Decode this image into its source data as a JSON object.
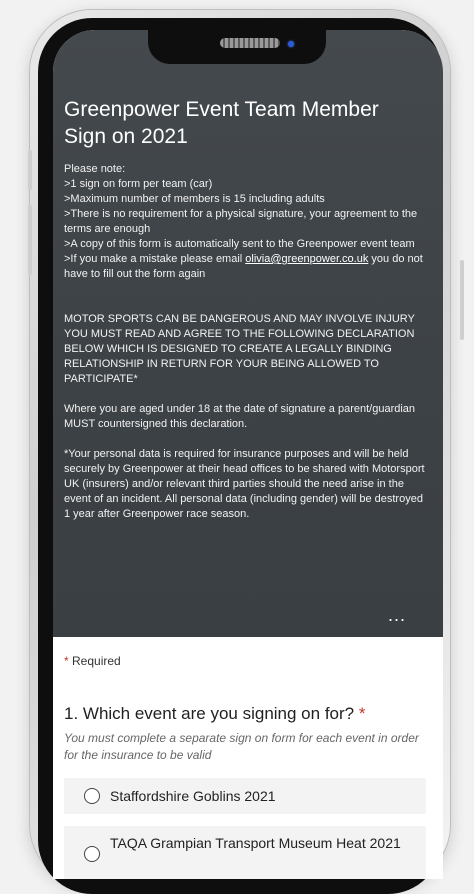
{
  "form": {
    "title": "Greenpower Event Team Member Sign on 2021",
    "notes": [
      "Please note:",
      ">1 sign on form per team (car)",
      ">Maximum number of members is 15 including adults",
      ">There is no requirement for a physical signature, your agreement to the terms are enough",
      ">A copy of this form is automatically sent to the Greenpower event team"
    ],
    "mistake_prefix": ">If you make a mistake please email ",
    "mistake_email": "olivia@greenpower.co.uk",
    "mistake_suffix": " you do not have to fill out the form again",
    "warning": "MOTOR SPORTS CAN BE DANGEROUS AND MAY INVOLVE INJURY YOU MUST READ AND AGREE TO THE FOLLOWING DECLARATION BELOW WHICH IS DESIGNED TO CREATE A LEGALLY BINDING RELATIONSHIP IN RETURN FOR YOUR BEING ALLOWED TO PARTICIPATE*",
    "guardian_note": "Where you are aged under 18 at the date of signature a parent/guardian MUST countersigned this declaration.",
    "data_note": "*Your personal data is required for insurance purposes and will be held securely by Greenpower at their head offices to be shared with Motorsport UK  (insurers) and/or relevant third parties should the need arise in the event of an incident.  All personal data (including gender) will be destroyed 1 year after Greenpower race season.",
    "more_label": "...",
    "required_label": "Required",
    "required_star": "*"
  },
  "question1": {
    "label": "1. Which event are you signing on for?",
    "star": "*",
    "hint": "You must complete a separate sign on form for each event in order for the insurance to be valid",
    "options": [
      "Staffordshire Goblins 2021",
      "TAQA Grampian Transport Museum Heat 2021"
    ]
  }
}
